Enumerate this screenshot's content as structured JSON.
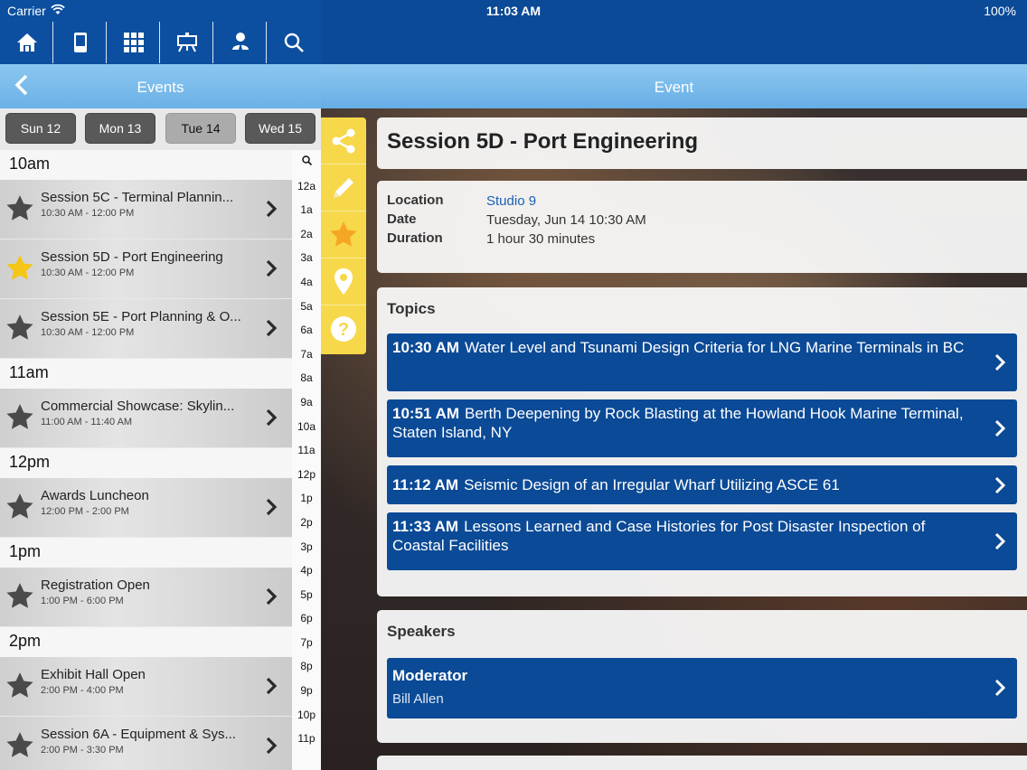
{
  "status": {
    "carrier": "Carrier",
    "time": "11:03 AM",
    "battery": "100%"
  },
  "toolbar": {
    "icons": [
      "home-icon",
      "mobile-device-icon",
      "grid-icon",
      "presentation-board-icon",
      "person-icon",
      "search-icon"
    ]
  },
  "left_header": {
    "title": "Events"
  },
  "right_header": {
    "title": "Event"
  },
  "day_tabs": [
    {
      "label": "Sun 12",
      "active": false
    },
    {
      "label": "Mon 13",
      "active": false
    },
    {
      "label": "Tue 14",
      "active": true
    },
    {
      "label": "Wed 15",
      "active": false
    }
  ],
  "schedule": [
    {
      "hour": "10am",
      "items": [
        {
          "title": "Session 5C - Terminal Plannin...",
          "time": "10:30 AM - 12:00 PM",
          "starred": false
        },
        {
          "title": "Session 5D - Port Engineering",
          "time": "10:30 AM - 12:00 PM",
          "starred": true
        },
        {
          "title": "Session 5E - Port Planning & O...",
          "time": "10:30 AM - 12:00 PM",
          "starred": false
        }
      ]
    },
    {
      "hour": "11am",
      "items": [
        {
          "title": "Commercial Showcase: Skylin...",
          "time": "11:00 AM - 11:40 AM",
          "starred": false
        }
      ]
    },
    {
      "hour": "12pm",
      "items": [
        {
          "title": "Awards Luncheon",
          "time": "12:00 PM - 2:00 PM",
          "starred": false
        }
      ]
    },
    {
      "hour": "1pm",
      "items": [
        {
          "title": "Registration Open",
          "time": "1:00 PM - 6:00 PM",
          "starred": false
        }
      ]
    },
    {
      "hour": "2pm",
      "items": [
        {
          "title": "Exhibit Hall Open",
          "time": "2:00 PM - 4:00 PM",
          "starred": false
        },
        {
          "title": "Session 6A - Equipment & Sys...",
          "time": "2:00 PM - 3:30 PM",
          "starred": false
        }
      ]
    }
  ],
  "hour_index": [
    "12a",
    "1a",
    "2a",
    "3a",
    "4a",
    "5a",
    "6a",
    "7a",
    "8a",
    "9a",
    "10a",
    "11a",
    "12p",
    "1p",
    "2p",
    "3p",
    "4p",
    "5p",
    "6p",
    "7p",
    "8p",
    "9p",
    "10p",
    "11p"
  ],
  "action_bar": {
    "icons": [
      "share-icon",
      "pencil-icon",
      "star-icon",
      "location-pin-icon",
      "help-icon"
    ]
  },
  "event": {
    "title": "Session 5D - Port Engineering",
    "location_label": "Location",
    "location": "Studio 9",
    "date_label": "Date",
    "date": "Tuesday, Jun 14 10:30 AM",
    "duration_label": "Duration",
    "duration": "1 hour 30 minutes",
    "topics_heading": "Topics",
    "topics": [
      {
        "time": "10:30 AM",
        "title": "Water Level and Tsunami Design Criteria for LNG Marine Terminals in BC"
      },
      {
        "time": "10:51 AM",
        "title": "Berth Deepening by Rock Blasting at the Howland Hook Marine Terminal, Staten Island, NY"
      },
      {
        "time": "11:12 AM",
        "title": "Seismic Design of an Irregular Wharf Utilizing ASCE 61"
      },
      {
        "time": "11:33 AM",
        "title": "Lessons Learned and Case Histories for Post Disaster Inspection of Coastal Facilities"
      }
    ],
    "speakers_heading": "Speakers",
    "moderator_role": "Moderator",
    "moderator_name": "Bill Allen"
  },
  "colors": {
    "nav_blue": "#0b4a96",
    "header_blue": "#7cbdeb",
    "action_yellow": "#f6d84a",
    "star_gold": "#f5c518",
    "link_blue": "#1a5fb4"
  }
}
